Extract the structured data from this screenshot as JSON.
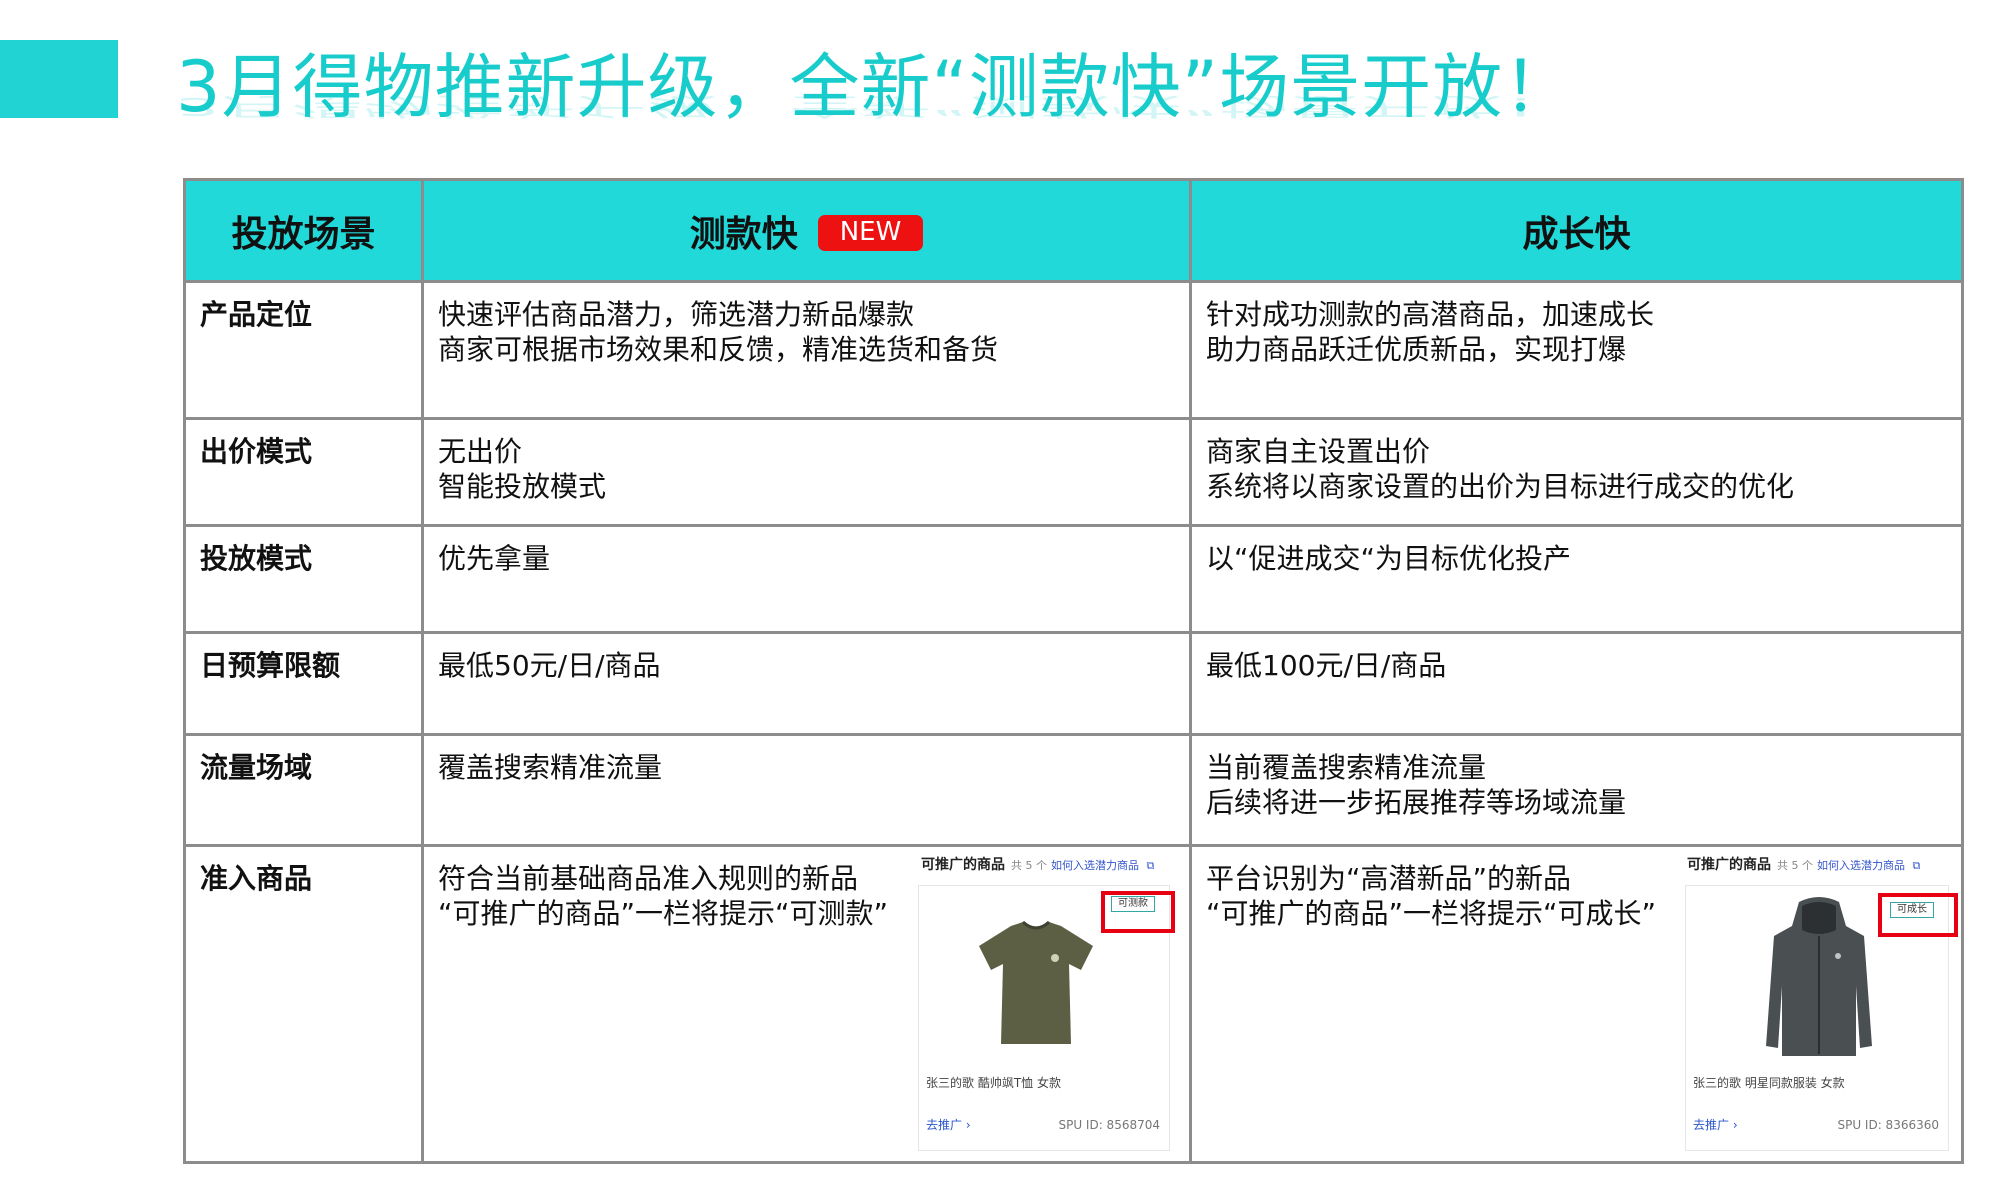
{
  "title": "3月得物推新升级，全新“测款快”场景开放！",
  "colors": {
    "accent": "#22d3d3",
    "header_bg": "#22d9d9",
    "badge": "#ee1111",
    "highlight_box": "#e60012"
  },
  "table": {
    "headers": {
      "label": "投放场景",
      "col1": "测款快",
      "col1_badge": "NEW",
      "col2": "成长快"
    },
    "rows": [
      {
        "label": "产品定位",
        "col1": [
          "快速评估商品潜力，筛选潜力新品爆款",
          "商家可根据市场效果和反馈，精准选货和备货"
        ],
        "col2": [
          "针对成功测款的高潜商品，加速成长",
          "助力商品跃迁优质新品，实现打爆"
        ]
      },
      {
        "label": "出价模式",
        "col1": [
          "无出价",
          "智能投放模式"
        ],
        "col2": [
          "商家自主设置出价",
          "系统将以商家设置的出价为目标进行成交的优化"
        ]
      },
      {
        "label": "投放模式",
        "col1": [
          "优先拿量"
        ],
        "col2": [
          "以“促进成交“为目标优化投产"
        ]
      },
      {
        "label": "日预算限额",
        "col1": [
          "最低50元/日/商品"
        ],
        "col2": [
          "最低100元/日/商品"
        ]
      },
      {
        "label": "流量场域",
        "col1": [
          "覆盖搜索精准流量"
        ],
        "col2": [
          "当前覆盖搜索精准流量",
          "后续将进一步拓展推荐等场域流量"
        ]
      },
      {
        "label": "准入商品",
        "col1": [
          "符合当前基础商品准入规则的新品",
          "“可推广的商品”一栏将提示“可测款”"
        ],
        "col2": [
          "平台识别为“高潜新品”的新品",
          "“可推广的商品”一栏将提示“可成长”"
        ]
      }
    ]
  },
  "cards": [
    {
      "header": "可推广的商品",
      "count": "共 5 个",
      "link": "如何入选潜力商品",
      "tag": "可测款",
      "product": "张三的歌 酷帅飒T恤 女款",
      "go": "去推广 ›",
      "spu": "SPU ID: 8568704",
      "image": "tshirt",
      "image_color": "#5c5f44"
    },
    {
      "header": "可推广的商品",
      "count": "共 5 个",
      "link": "如何入选潜力商品",
      "tag": "可成长",
      "product": "张三的歌 明星同款服装 女款",
      "go": "去推广 ›",
      "spu": "SPU ID: 8366360",
      "image": "jacket",
      "image_color": "#4a4f52"
    }
  ]
}
